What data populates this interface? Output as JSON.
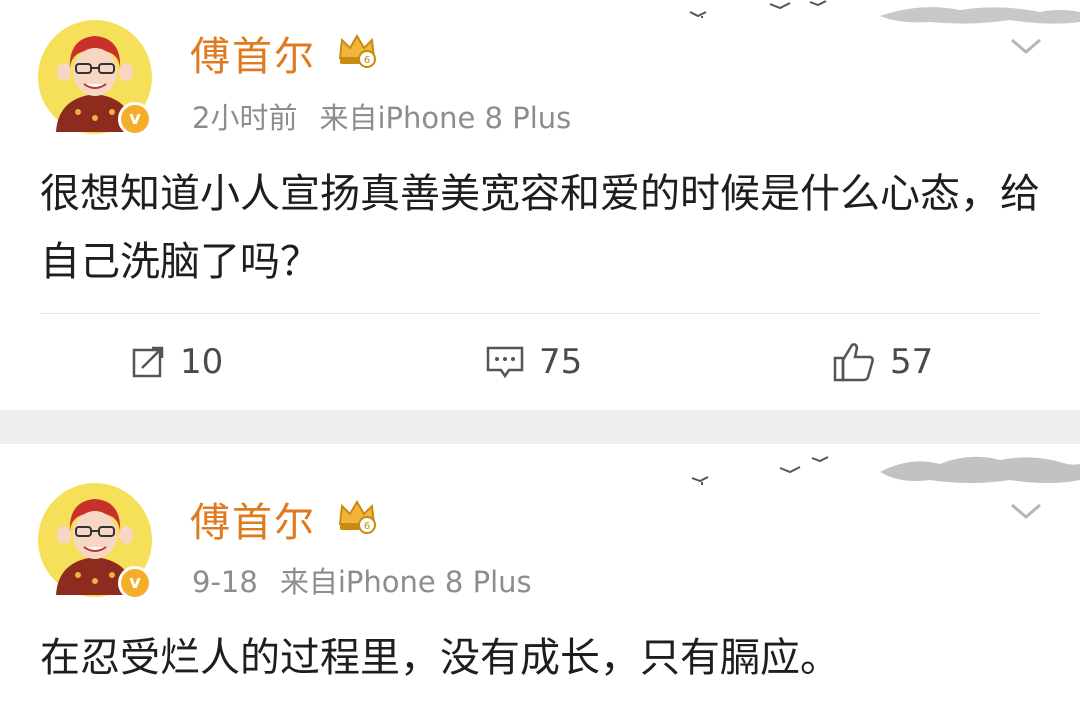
{
  "posts": [
    {
      "username": "傅首尔",
      "time": "2小时前",
      "source": "来自iPhone 8 Plus",
      "text": "很想知道小人宣扬真善美宽容和爱的时候是什么心态，给自己洗脑了吗？",
      "reposts": "10",
      "comments": "75",
      "likes": "57"
    },
    {
      "username": "傅首尔",
      "time": "9-18",
      "source": "来自iPhone 8 Plus",
      "text": "在忍受烂人的过程里，没有成长，只有膈应。"
    }
  ],
  "colors": {
    "username": "#e07a1f",
    "verified_badge": "#f5ad2a",
    "avatar_bg": "#f6e05a"
  },
  "icons": {
    "verified": "v-badge-icon",
    "crown": "crown-vip-icon",
    "more": "chevron-down-icon",
    "repost": "repost-icon",
    "comment": "comment-icon",
    "like": "thumbs-up-icon"
  }
}
